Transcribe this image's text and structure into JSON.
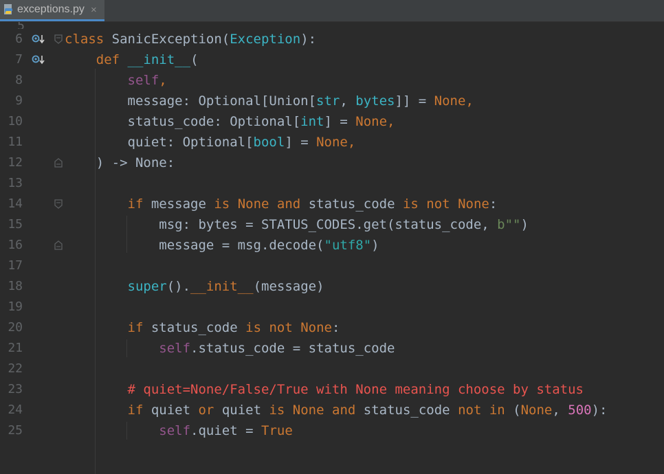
{
  "tab": {
    "filename": "exceptions.py",
    "close_glyph": "×",
    "icon": "python-file-icon"
  },
  "gutter": {
    "override_icon": "override-method-icon",
    "fold_icon": "fold-marker-icon"
  },
  "colors": {
    "background": "#2b2b2b",
    "keyword": "#cc7832",
    "self": "#94558d",
    "builtin": "#3cb4c4",
    "string": "#6a8759",
    "number": "#d874b8",
    "comment": "#e8544f",
    "text": "#a9b7c6"
  },
  "lines": [
    {
      "n": "6",
      "tokens": [
        [
          "kw",
          "class"
        ],
        [
          "t",
          " SanicException("
        ],
        [
          "builtin",
          "Exception"
        ],
        [
          "t",
          "):"
        ]
      ]
    },
    {
      "n": "7",
      "tokens": [
        [
          "t",
          "    "
        ],
        [
          "kw",
          "def"
        ],
        [
          "t",
          " "
        ],
        [
          "builtin",
          "__init__"
        ],
        [
          "t",
          "("
        ]
      ]
    },
    {
      "n": "8",
      "tokens": [
        [
          "t",
          "        "
        ],
        [
          "self",
          "self"
        ],
        [
          "kw",
          ","
        ]
      ]
    },
    {
      "n": "9",
      "tokens": [
        [
          "t",
          "        message: Optional[Union["
        ],
        [
          "builtin",
          "str"
        ],
        [
          "t",
          ", "
        ],
        [
          "builtin",
          "bytes"
        ],
        [
          "t",
          "]] = "
        ],
        [
          "kw",
          "None"
        ],
        [
          "kw",
          ","
        ]
      ]
    },
    {
      "n": "10",
      "tokens": [
        [
          "t",
          "        status_code: Optional["
        ],
        [
          "builtin",
          "int"
        ],
        [
          "t",
          "] = "
        ],
        [
          "kw",
          "None"
        ],
        [
          "kw",
          ","
        ]
      ]
    },
    {
      "n": "11",
      "tokens": [
        [
          "t",
          "        quiet: Optional["
        ],
        [
          "builtin",
          "bool"
        ],
        [
          "t",
          "] = "
        ],
        [
          "kw",
          "None"
        ],
        [
          "kw",
          ","
        ]
      ]
    },
    {
      "n": "12",
      "tokens": [
        [
          "t",
          "    ) -> None:"
        ]
      ]
    },
    {
      "n": "13",
      "tokens": []
    },
    {
      "n": "14",
      "tokens": [
        [
          "t",
          "        "
        ],
        [
          "kw",
          "if"
        ],
        [
          "t",
          " message "
        ],
        [
          "kw",
          "is"
        ],
        [
          "t",
          " "
        ],
        [
          "kw",
          "None"
        ],
        [
          "t",
          " "
        ],
        [
          "kw",
          "and"
        ],
        [
          "t",
          " status_code "
        ],
        [
          "kw",
          "is not"
        ],
        [
          "t",
          " "
        ],
        [
          "kw",
          "None"
        ],
        [
          "t",
          ":"
        ]
      ]
    },
    {
      "n": "15",
      "tokens": [
        [
          "t",
          "            msg: bytes = STATUS_CODES.get(status_code, "
        ],
        [
          "str",
          "b\"\""
        ],
        [
          "t",
          ")"
        ]
      ]
    },
    {
      "n": "16",
      "tokens": [
        [
          "t",
          "            message = msg.decode("
        ],
        [
          "str2",
          "\"utf8\""
        ],
        [
          "t",
          ")"
        ]
      ]
    },
    {
      "n": "17",
      "tokens": []
    },
    {
      "n": "18",
      "tokens": [
        [
          "t",
          "        "
        ],
        [
          "builtin",
          "super"
        ],
        [
          "t",
          "()."
        ],
        [
          "kw",
          "__init__"
        ],
        [
          "t",
          "(message)"
        ]
      ]
    },
    {
      "n": "19",
      "tokens": []
    },
    {
      "n": "20",
      "tokens": [
        [
          "t",
          "        "
        ],
        [
          "kw",
          "if"
        ],
        [
          "t",
          " status_code "
        ],
        [
          "kw",
          "is not"
        ],
        [
          "t",
          " "
        ],
        [
          "kw",
          "None"
        ],
        [
          "t",
          ":"
        ]
      ]
    },
    {
      "n": "21",
      "tokens": [
        [
          "t",
          "            "
        ],
        [
          "self",
          "self"
        ],
        [
          "t",
          ".status_code = status_code"
        ]
      ]
    },
    {
      "n": "22",
      "tokens": []
    },
    {
      "n": "23",
      "tokens": [
        [
          "t",
          "        "
        ],
        [
          "comment",
          "# quiet=None/False/True with None meaning choose by status"
        ]
      ]
    },
    {
      "n": "24",
      "tokens": [
        [
          "t",
          "        "
        ],
        [
          "kw",
          "if"
        ],
        [
          "t",
          " quiet "
        ],
        [
          "kw",
          "or"
        ],
        [
          "t",
          " quiet "
        ],
        [
          "kw",
          "is"
        ],
        [
          "t",
          " "
        ],
        [
          "kw",
          "None"
        ],
        [
          "t",
          " "
        ],
        [
          "kw",
          "and"
        ],
        [
          "t",
          " status_code "
        ],
        [
          "kw",
          "not in"
        ],
        [
          "t",
          " ("
        ],
        [
          "kw",
          "None"
        ],
        [
          "t",
          ", "
        ],
        [
          "num",
          "500"
        ],
        [
          "t",
          "):"
        ]
      ]
    },
    {
      "n": "25",
      "tokens": [
        [
          "t",
          "            "
        ],
        [
          "self",
          "self"
        ],
        [
          "t",
          ".quiet = "
        ],
        [
          "kw",
          "True"
        ]
      ]
    }
  ]
}
